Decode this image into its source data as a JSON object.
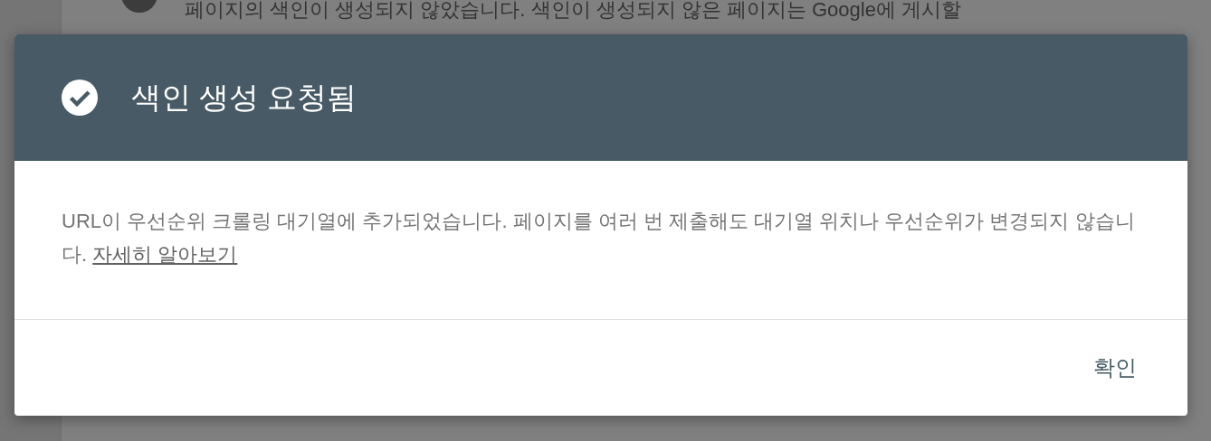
{
  "background_page": {
    "notice": "페이지의 색인이 생성되지 않았습니다. 색인이 생성되지 않은 페이지는 Google에 게시할"
  },
  "dialog": {
    "title": "색인 생성 요청됨",
    "message": "URL이 우선순위 크롤링 대기열에 추가되었습니다. 페이지를 여러 번 제출해도 대기열 위치나 우선순위가 변경되지 않습니다.",
    "link": "자세히 알아보기",
    "buttons": [
      "확인"
    ]
  }
}
